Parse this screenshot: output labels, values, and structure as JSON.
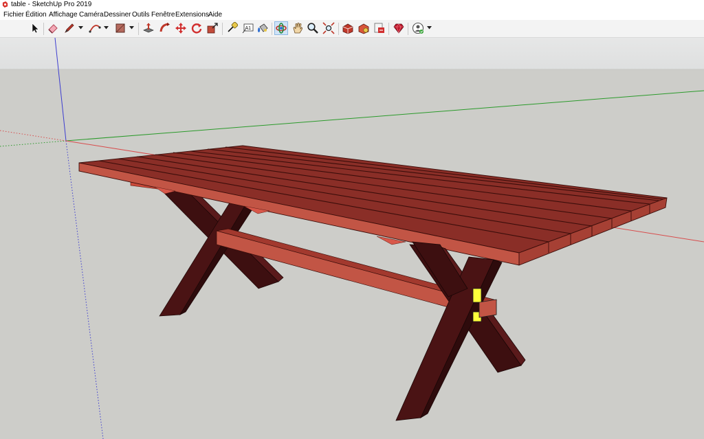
{
  "window": {
    "title": "table - SketchUp Pro 2019"
  },
  "menu": [
    "Fichier",
    "Édition",
    "Affichage",
    "Caméra",
    "Dessiner",
    "Outils",
    "Fenêtre",
    "Extensions",
    "Aide"
  ],
  "toolbar": {
    "tools": [
      {
        "name": "select-tool-button",
        "icon": "arrow-cursor-icon"
      },
      {
        "name": "eraser-tool-button",
        "icon": "eraser-icon"
      },
      {
        "name": "line-tool-button",
        "icon": "pencil-icon"
      },
      {
        "name": "arc-tool-button",
        "icon": "arc-icon"
      },
      {
        "name": "rectangle-tool-button",
        "icon": "rectangle-icon"
      },
      {
        "name": "push-pull-tool-button",
        "icon": "push-pull-icon"
      },
      {
        "name": "follow-me-tool-button",
        "icon": "follow-me-icon"
      },
      {
        "name": "move-tool-button",
        "icon": "move-icon"
      },
      {
        "name": "rotate-tool-button",
        "icon": "rotate-icon"
      },
      {
        "name": "scale-tool-button",
        "icon": "scale-icon"
      },
      {
        "name": "tape-measure-tool-button",
        "icon": "tape-measure-icon"
      },
      {
        "name": "text-tool-button",
        "icon": "text-icon"
      },
      {
        "name": "paint-bucket-tool-button",
        "icon": "paint-bucket-icon"
      },
      {
        "name": "orbit-tool-button",
        "icon": "orbit-icon"
      },
      {
        "name": "pan-tool-button",
        "icon": "hand-icon"
      },
      {
        "name": "zoom-tool-button",
        "icon": "magnifier-icon"
      },
      {
        "name": "zoom-extents-tool-button",
        "icon": "zoom-extents-icon"
      },
      {
        "name": "3d-warehouse-button",
        "icon": "warehouse-icon"
      },
      {
        "name": "extension-warehouse-button",
        "icon": "extension-warehouse-icon"
      },
      {
        "name": "send-to-layout-button",
        "icon": "layout-icon"
      },
      {
        "name": "ruby-console-button",
        "icon": "ruby-icon"
      },
      {
        "name": "account-button",
        "icon": "user-account-icon"
      }
    ],
    "text_tool_glyph": "A1",
    "active_tool": "orbit-tool-button"
  },
  "colors": {
    "sky": "#e4e5e5",
    "ground": "#cdcdc9",
    "wood_top": "#8a2e27",
    "wood_front": "#c25545",
    "wood_dark": "#471112",
    "selection_highlight": "#ffff3b",
    "axis_red": "#d84b4b",
    "axis_green": "#2a9a2a",
    "axis_blue": "#3c3cd0"
  }
}
